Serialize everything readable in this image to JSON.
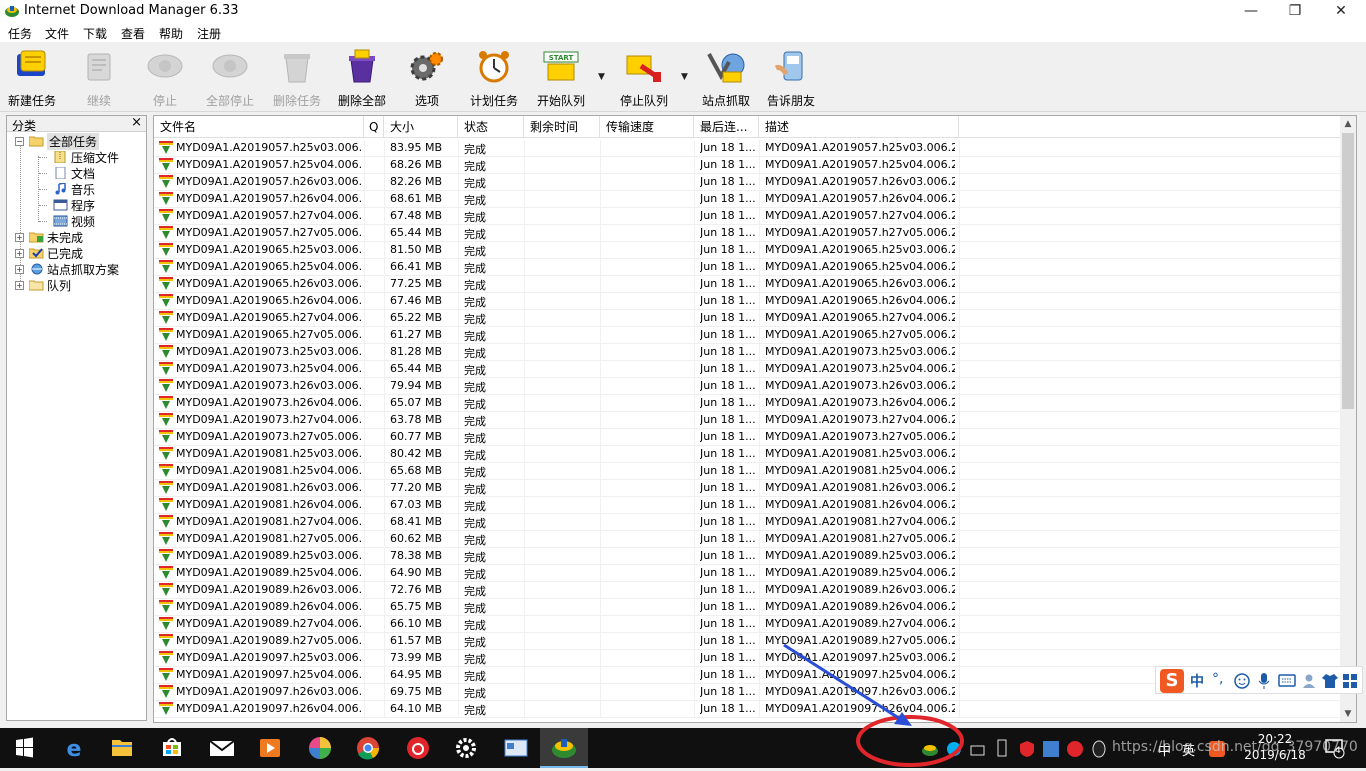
{
  "window": {
    "title": "Internet Download Manager 6.33",
    "controls": {
      "minimize": "—",
      "maximize": "❐",
      "close": "✕"
    }
  },
  "menubar": [
    "任务",
    "文件",
    "下载",
    "查看",
    "帮助",
    "注册"
  ],
  "toolbar": {
    "new_task": "新建任务",
    "resume": "继续",
    "stop": "停止",
    "stop_all": "全部停止",
    "delete_task": "删除任务",
    "delete_all": "删除全部",
    "options": "选项",
    "scheduler": "计划任务",
    "start_queue": "开始队列",
    "stop_queue": "停止队列",
    "site_grabber": "站点抓取",
    "tell_friend": "告诉朋友",
    "start_badge": "START"
  },
  "categories": {
    "header": "分类",
    "close": "×",
    "all": "全部任务",
    "compressed": "压缩文件",
    "documents": "文档",
    "music": "音乐",
    "programs": "程序",
    "video": "视频",
    "unfinished": "未完成",
    "finished": "已完成",
    "grabber": "站点抓取方案",
    "queues": "队列"
  },
  "columns": {
    "filename": "文件名",
    "q": "Q",
    "size": "大小",
    "status": "状态",
    "time_left": "剩余时间",
    "speed": "传输速度",
    "last_try": "最后连...",
    "description": "描述"
  },
  "rows": [
    {
      "name": "MYD09A1.A2019057.h25v03.006.2...",
      "size": "83.95  MB",
      "status": "完成",
      "last": "Jun 18 1...",
      "desc": "MYD09A1.A2019057.h25v03.006.2..."
    },
    {
      "name": "MYD09A1.A2019057.h25v04.006.2...",
      "size": "68.26  MB",
      "status": "完成",
      "last": "Jun 18 1...",
      "desc": "MYD09A1.A2019057.h25v04.006.2..."
    },
    {
      "name": "MYD09A1.A2019057.h26v03.006.2...",
      "size": "82.26  MB",
      "status": "完成",
      "last": "Jun 18 1...",
      "desc": "MYD09A1.A2019057.h26v03.006.2..."
    },
    {
      "name": "MYD09A1.A2019057.h26v04.006.2...",
      "size": "68.61  MB",
      "status": "完成",
      "last": "Jun 18 1...",
      "desc": "MYD09A1.A2019057.h26v04.006.2..."
    },
    {
      "name": "MYD09A1.A2019057.h27v04.006.2...",
      "size": "67.48  MB",
      "status": "完成",
      "last": "Jun 18 1...",
      "desc": "MYD09A1.A2019057.h27v04.006.2..."
    },
    {
      "name": "MYD09A1.A2019057.h27v05.006.2...",
      "size": "65.44  MB",
      "status": "完成",
      "last": "Jun 18 1...",
      "desc": "MYD09A1.A2019057.h27v05.006.2..."
    },
    {
      "name": "MYD09A1.A2019065.h25v03.006.2...",
      "size": "81.50  MB",
      "status": "完成",
      "last": "Jun 18 1...",
      "desc": "MYD09A1.A2019065.h25v03.006.2..."
    },
    {
      "name": "MYD09A1.A2019065.h25v04.006.2...",
      "size": "66.41  MB",
      "status": "完成",
      "last": "Jun 18 1...",
      "desc": "MYD09A1.A2019065.h25v04.006.2..."
    },
    {
      "name": "MYD09A1.A2019065.h26v03.006.2...",
      "size": "77.25  MB",
      "status": "完成",
      "last": "Jun 18 1...",
      "desc": "MYD09A1.A2019065.h26v03.006.2..."
    },
    {
      "name": "MYD09A1.A2019065.h26v04.006.2...",
      "size": "67.46  MB",
      "status": "完成",
      "last": "Jun 18 1...",
      "desc": "MYD09A1.A2019065.h26v04.006.2..."
    },
    {
      "name": "MYD09A1.A2019065.h27v04.006.2...",
      "size": "65.22  MB",
      "status": "完成",
      "last": "Jun 18 1...",
      "desc": "MYD09A1.A2019065.h27v04.006.2..."
    },
    {
      "name": "MYD09A1.A2019065.h27v05.006.2...",
      "size": "61.27  MB",
      "status": "完成",
      "last": "Jun 18 1...",
      "desc": "MYD09A1.A2019065.h27v05.006.2..."
    },
    {
      "name": "MYD09A1.A2019073.h25v03.006.2...",
      "size": "81.28  MB",
      "status": "完成",
      "last": "Jun 18 1...",
      "desc": "MYD09A1.A2019073.h25v03.006.2..."
    },
    {
      "name": "MYD09A1.A2019073.h25v04.006.2...",
      "size": "65.44  MB",
      "status": "完成",
      "last": "Jun 18 1...",
      "desc": "MYD09A1.A2019073.h25v04.006.2..."
    },
    {
      "name": "MYD09A1.A2019073.h26v03.006.2...",
      "size": "79.94  MB",
      "status": "完成",
      "last": "Jun 18 1...",
      "desc": "MYD09A1.A2019073.h26v03.006.2..."
    },
    {
      "name": "MYD09A1.A2019073.h26v04.006.2...",
      "size": "65.07  MB",
      "status": "完成",
      "last": "Jun 18 1...",
      "desc": "MYD09A1.A2019073.h26v04.006.2..."
    },
    {
      "name": "MYD09A1.A2019073.h27v04.006.2...",
      "size": "63.78  MB",
      "status": "完成",
      "last": "Jun 18 1...",
      "desc": "MYD09A1.A2019073.h27v04.006.2..."
    },
    {
      "name": "MYD09A1.A2019073.h27v05.006.2...",
      "size": "60.77  MB",
      "status": "完成",
      "last": "Jun 18 1...",
      "desc": "MYD09A1.A2019073.h27v05.006.2..."
    },
    {
      "name": "MYD09A1.A2019081.h25v03.006.2...",
      "size": "80.42  MB",
      "status": "完成",
      "last": "Jun 18 1...",
      "desc": "MYD09A1.A2019081.h25v03.006.2..."
    },
    {
      "name": "MYD09A1.A2019081.h25v04.006.2...",
      "size": "65.68  MB",
      "status": "完成",
      "last": "Jun 18 1...",
      "desc": "MYD09A1.A2019081.h25v04.006.2..."
    },
    {
      "name": "MYD09A1.A2019081.h26v03.006.2...",
      "size": "77.20  MB",
      "status": "完成",
      "last": "Jun 18 1...",
      "desc": "MYD09A1.A2019081.h26v03.006.2..."
    },
    {
      "name": "MYD09A1.A2019081.h26v04.006.2...",
      "size": "67.03  MB",
      "status": "完成",
      "last": "Jun 18 1...",
      "desc": "MYD09A1.A2019081.h26v04.006.2..."
    },
    {
      "name": "MYD09A1.A2019081.h27v04.006.2...",
      "size": "68.41  MB",
      "status": "完成",
      "last": "Jun 18 1...",
      "desc": "MYD09A1.A2019081.h27v04.006.2..."
    },
    {
      "name": "MYD09A1.A2019081.h27v05.006.2...",
      "size": "60.62  MB",
      "status": "完成",
      "last": "Jun 18 1...",
      "desc": "MYD09A1.A2019081.h27v05.006.2..."
    },
    {
      "name": "MYD09A1.A2019089.h25v03.006.2...",
      "size": "78.38  MB",
      "status": "完成",
      "last": "Jun 18 1...",
      "desc": "MYD09A1.A2019089.h25v03.006.2..."
    },
    {
      "name": "MYD09A1.A2019089.h25v04.006.2...",
      "size": "64.90  MB",
      "status": "完成",
      "last": "Jun 18 1...",
      "desc": "MYD09A1.A2019089.h25v04.006.2..."
    },
    {
      "name": "MYD09A1.A2019089.h26v03.006.2...",
      "size": "72.76  MB",
      "status": "完成",
      "last": "Jun 18 1...",
      "desc": "MYD09A1.A2019089.h26v03.006.2..."
    },
    {
      "name": "MYD09A1.A2019089.h26v04.006.2...",
      "size": "65.75  MB",
      "status": "完成",
      "last": "Jun 18 1...",
      "desc": "MYD09A1.A2019089.h26v04.006.2..."
    },
    {
      "name": "MYD09A1.A2019089.h27v04.006.2...",
      "size": "66.10  MB",
      "status": "完成",
      "last": "Jun 18 1...",
      "desc": "MYD09A1.A2019089.h27v04.006.2..."
    },
    {
      "name": "MYD09A1.A2019089.h27v05.006.2...",
      "size": "61.57  MB",
      "status": "完成",
      "last": "Jun 18 1...",
      "desc": "MYD09A1.A2019089.h27v05.006.2..."
    },
    {
      "name": "MYD09A1.A2019097.h25v03.006.2...",
      "size": "73.99  MB",
      "status": "完成",
      "last": "Jun 18 1...",
      "desc": "MYD09A1.A2019097.h25v03.006.2..."
    },
    {
      "name": "MYD09A1.A2019097.h25v04.006.2...",
      "size": "64.95  MB",
      "status": "完成",
      "last": "Jun 18 1...",
      "desc": "MYD09A1.A2019097.h25v04.006.2..."
    },
    {
      "name": "MYD09A1.A2019097.h26v03.006.2...",
      "size": "69.75  MB",
      "status": "完成",
      "last": "Jun 18 1...",
      "desc": "MYD09A1.A2019097.h26v03.006.2..."
    },
    {
      "name": "MYD09A1.A2019097.h26v04.006.2...",
      "size": "64.10  MB",
      "status": "完成",
      "last": "Jun 18 1...",
      "desc": "MYD09A1.A2019097.h26v04.006.2..."
    }
  ],
  "ime": {
    "logo": "S",
    "mode": "中",
    "punct": "°,",
    "icons": [
      "smiley-icon",
      "microphone-icon",
      "keyboard-icon",
      "user-icon",
      "shirt-icon",
      "grid-icon"
    ]
  },
  "taskbar": {
    "apps": [
      "windows-start-icon",
      "edge-icon",
      "file-explorer-icon",
      "store-icon",
      "mail-icon",
      "media-player-icon",
      "photos-icon",
      "chrome-icon",
      "netease-music-icon",
      "settings-icon",
      "app-window-icon",
      "idm-icon"
    ],
    "tray_text": "英",
    "ime_text": "中",
    "time": "20:22",
    "date": "2019/6/18",
    "notification_count": "4"
  },
  "watermark": "https://blog.csdn.net/qq_37970770",
  "colors": {
    "annotation": "#e0262b",
    "arrow": "#2a4fd6",
    "accent": "#76b9ed"
  }
}
